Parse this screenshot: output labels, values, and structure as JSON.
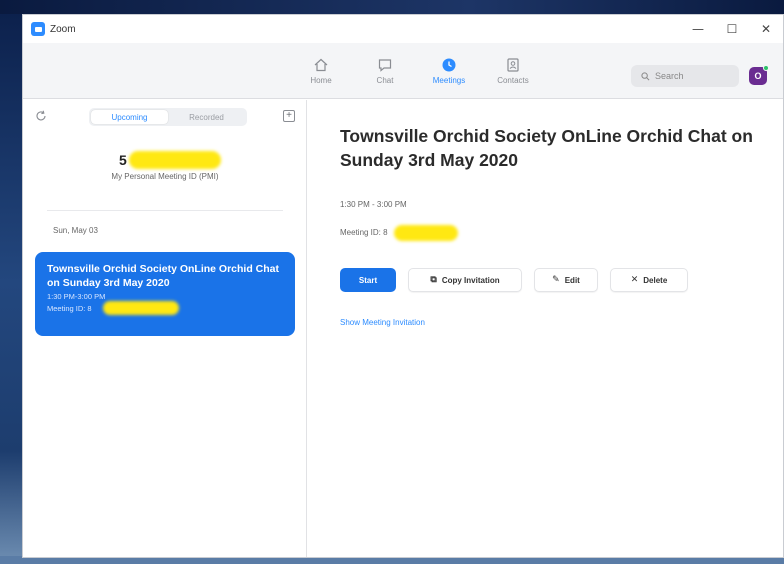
{
  "window": {
    "title": "Zoom",
    "controls": {
      "minimize": "—",
      "maximize": "☐",
      "close": "✕"
    }
  },
  "nav": {
    "tabs": [
      {
        "label": "Home",
        "icon": "home-icon"
      },
      {
        "label": "Chat",
        "icon": "chat-icon"
      },
      {
        "label": "Meetings",
        "icon": "clock-icon"
      },
      {
        "label": "Contacts",
        "icon": "contacts-icon"
      }
    ],
    "active_tab": "Meetings",
    "search_placeholder": "Search",
    "avatar_initial": "O",
    "accent_color": "#2d8cff"
  },
  "sidebar": {
    "tabs": {
      "upcoming": "Upcoming",
      "recorded": "Recorded"
    },
    "add_icon": "+",
    "pmi_prefix": "5",
    "pmi_label": "My Personal Meeting ID (PMI)",
    "date_header": "Sun, May 03",
    "selected_meeting": {
      "title": "Townsville Orchid Society OnLine Orchid Chat on Sunday 3rd May 2020",
      "time": "1:30 PM-3:00 PM",
      "id_label": "Meeting ID: 8"
    }
  },
  "detail": {
    "title": "Townsville Orchid Society OnLine Orchid Chat on Sunday 3rd May 2020",
    "time": "1:30 PM - 3:00 PM",
    "meeting_id_label": "Meeting ID: 8",
    "buttons": {
      "start": "Start",
      "copy": "Copy Invitation",
      "edit": "Edit",
      "delete": "Delete"
    },
    "show_invitation": "Show Meeting Invitation"
  }
}
